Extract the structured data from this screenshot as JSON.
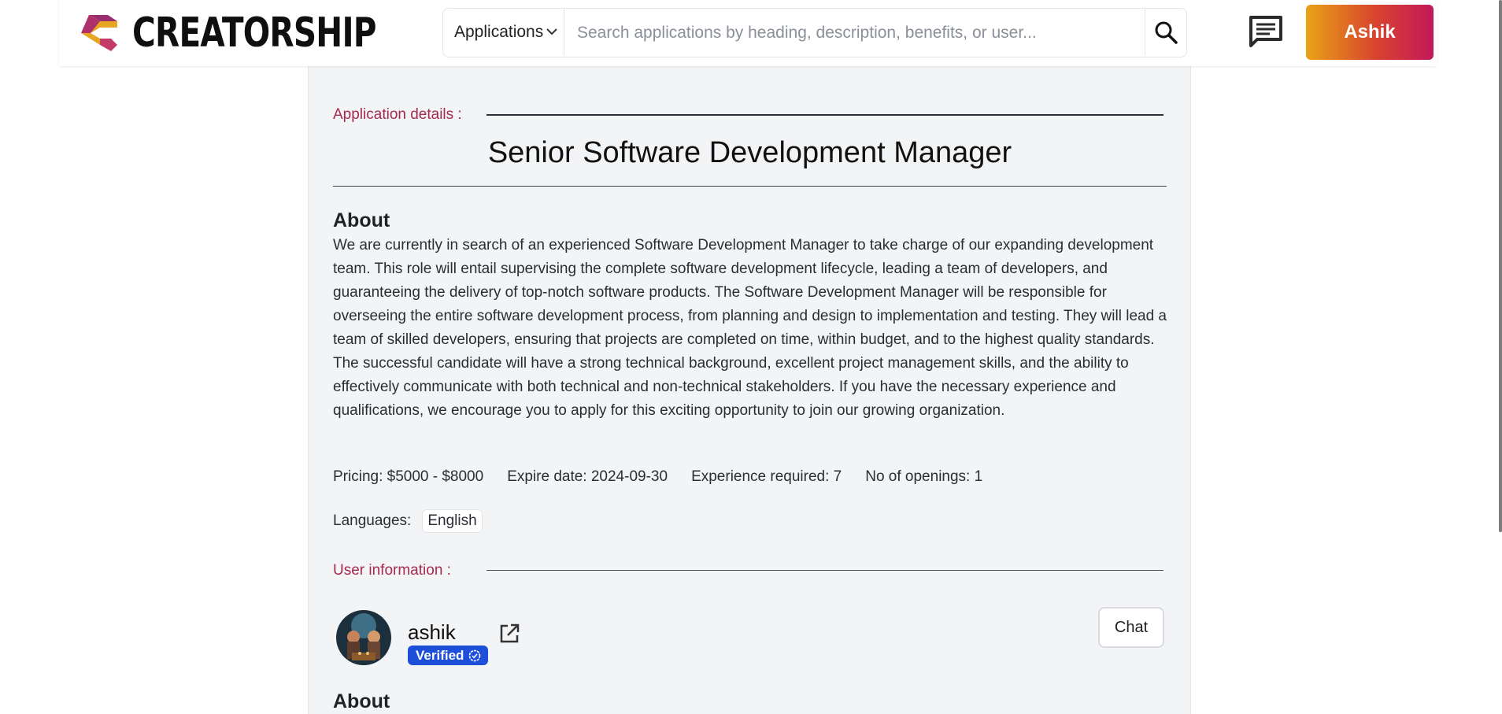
{
  "header": {
    "brand": "CREATORSHIP",
    "category_select": "Applications",
    "search_placeholder": "Search applications by heading, description, benefits, or user...",
    "user_button": "Ashik"
  },
  "details": {
    "section_label": "Application details :",
    "title": "Senior Software Development Manager",
    "about_heading": "About",
    "about_text": "We are currently in search of an experienced Software Development Manager to take charge of our expanding development team. This role will entail supervising the complete software development lifecycle, leading a team of developers, and guaranteeing the delivery of top-notch software products. The Software Development Manager will be responsible for overseeing the entire software development process, from planning and design to implementation and testing. They will lead a team of skilled developers, ensuring that projects are completed on time, within budget, and to the highest quality standards. The successful candidate will have a strong technical background, excellent project management skills, and the ability to effectively communicate with both technical and non-technical stakeholders. If you have the necessary experience and qualifications, we encourage you to apply for this exciting opportunity to join our growing organization.",
    "pricing": "Pricing: $5000 - $8000",
    "expire_date": "Expire date: 2024-09-30",
    "experience": "Experience required: 7",
    "openings": "No of openings: 1",
    "languages_label": "Languages:",
    "languages": [
      "English"
    ]
  },
  "user_info": {
    "section_label": "User information :",
    "name": "ashik",
    "verified_label": "Verified",
    "chat_button": "Chat",
    "about_heading": "About"
  },
  "colors": {
    "accent_label": "#a52a50",
    "verified_badge": "#1d4fd8",
    "user_button_gradient": [
      "#e9a316",
      "#c2185b"
    ]
  },
  "icons": {
    "logo": "creatorship-logo-icon",
    "chevron": "chevron-down-icon",
    "search": "search-icon",
    "messages": "message-icon",
    "external": "external-link-icon",
    "verified": "verified-check-icon"
  }
}
